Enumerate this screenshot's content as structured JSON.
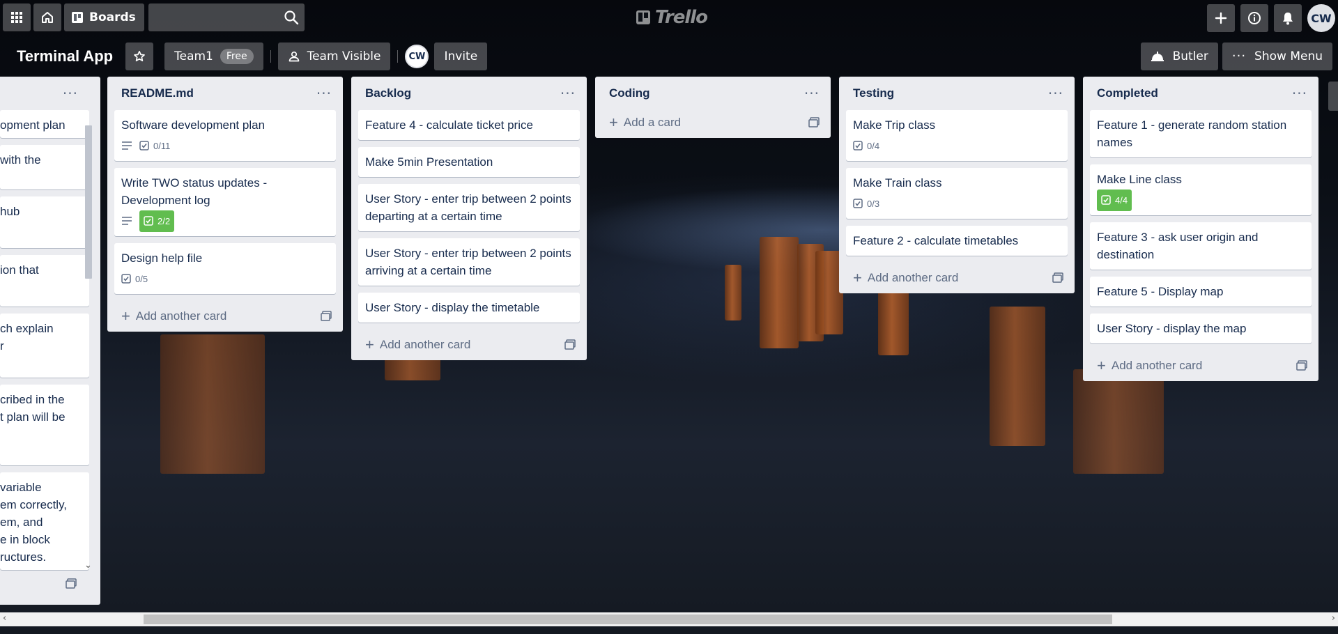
{
  "header": {
    "boards_label": "Boards",
    "logo_text": "Trello",
    "user_initials": "CW"
  },
  "board": {
    "title": "Terminal App",
    "team_label": "Team1",
    "team_plan_badge": "Free",
    "visibility_label": "Team Visible",
    "member_initials": "CW",
    "invite_label": "Invite",
    "butler_label": "Butler",
    "menu_label": "Show Menu"
  },
  "partial_list": {
    "cards": [
      "opment plan",
      "with the",
      "hub",
      "ion that",
      "ch explain\nr",
      "cribed in the\nt plan will be",
      "variable\nem correctly,\nem, and\ne in block\nructures."
    ]
  },
  "lists": [
    {
      "title": "README.md",
      "cards": [
        {
          "text": "Software development plan",
          "desc": true,
          "checklist": "0/11",
          "done": false
        },
        {
          "text": "Write TWO status updates - Development log",
          "desc": true,
          "checklist": "2/2",
          "done": true
        },
        {
          "text": "Design help file",
          "desc": false,
          "checklist": "0/5",
          "done": false
        }
      ],
      "add_label": "Add another card"
    },
    {
      "title": "Backlog",
      "cards": [
        {
          "text": "Feature 4 - calculate ticket price"
        },
        {
          "text": "Make 5min Presentation"
        },
        {
          "text": "User Story - enter trip between 2 points departing at a certain time"
        },
        {
          "text": "User Story - enter trip between 2 points arriving at a certain time"
        },
        {
          "text": "User Story - display the timetable"
        }
      ],
      "add_label": "Add another card"
    },
    {
      "title": "Coding",
      "cards": [],
      "add_label": "Add a card"
    },
    {
      "title": "Testing",
      "cards": [
        {
          "text": "Make Trip class",
          "checklist": "0/4",
          "done": false
        },
        {
          "text": "Make Train class",
          "checklist": "0/3",
          "done": false
        },
        {
          "text": "Feature 2 - calculate timetables"
        }
      ],
      "add_label": "Add another card"
    },
    {
      "title": "Completed",
      "cards": [
        {
          "text": "Feature 1 - generate random station names"
        },
        {
          "text": "Make Line class",
          "checklist": "4/4",
          "done": true
        },
        {
          "text": "Feature 3 - ask user origin and destination"
        },
        {
          "text": "Feature 5 - Display map"
        },
        {
          "text": "User Story - display the map"
        }
      ],
      "add_label": "Add another card"
    }
  ],
  "colors": {
    "list_bg": "#ebecf0",
    "complete_badge": "#61bd4f",
    "text": "#172b4d"
  }
}
